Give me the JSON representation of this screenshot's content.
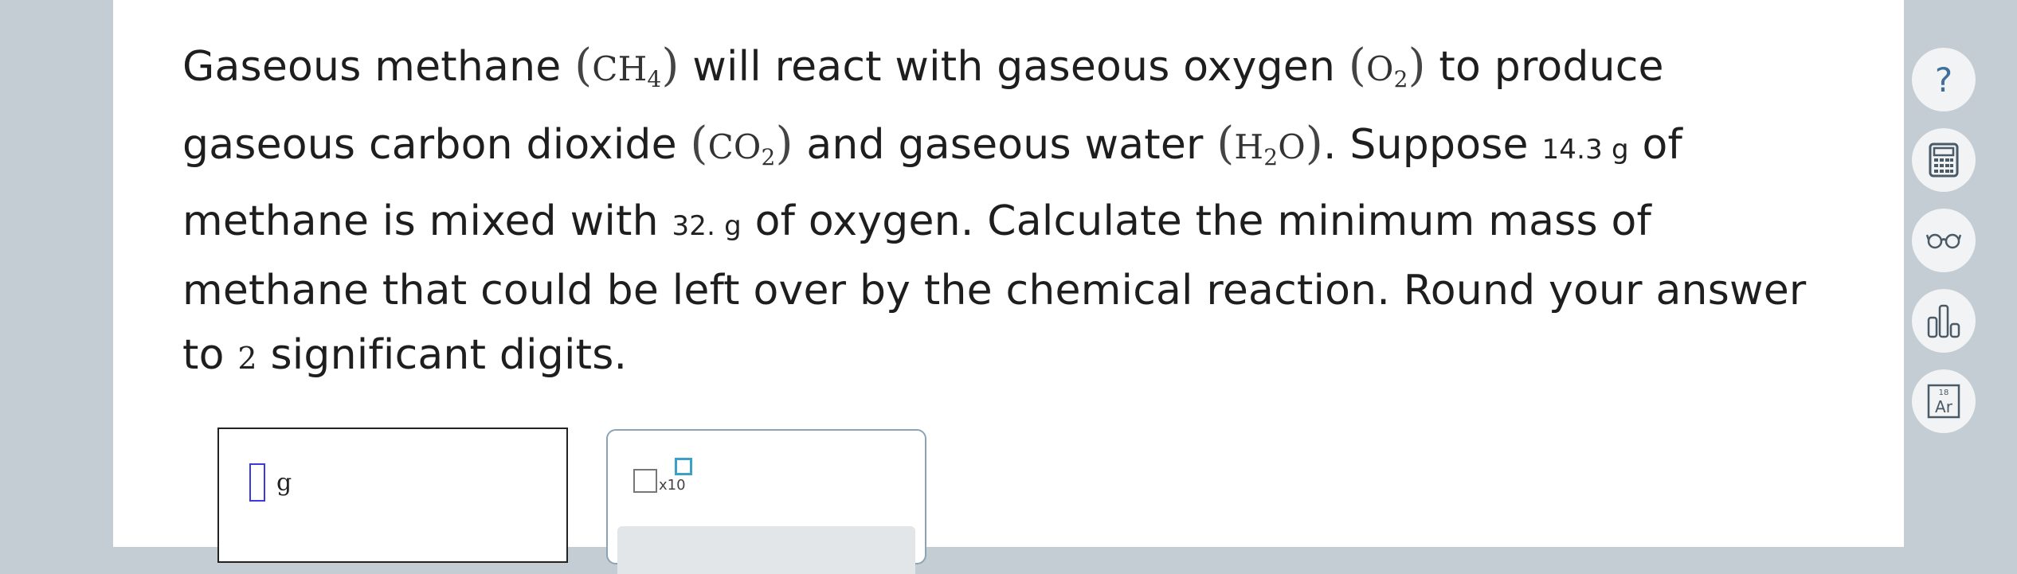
{
  "question": {
    "t1": "Gaseous methane ",
    "ch4_symbol": "CH",
    "ch4_sub": "4",
    "t2": " will react with gaseous oxygen ",
    "o2_symbol": "O",
    "o2_sub": "2",
    "t3": " to produce gaseous carbon dioxide ",
    "co2_symbol": "CO",
    "co2_sub": "2",
    "t4": " and gaseous water ",
    "h2o_h": "H",
    "h2o_sub": "2",
    "h2o_o": "O",
    "t5": ". Suppose ",
    "methane_mass": "14.3 g",
    "t6": " of methane is mixed with ",
    "oxygen_mass": "32. g",
    "t7": " of oxygen. Calculate the minimum mass of methane that could be left over by the chemical reaction. Round your answer to ",
    "sig_digits": "2",
    "t8": " significant digits."
  },
  "tools": [
    {
      "name": "help",
      "icon": "question-icon",
      "glyph": "?"
    },
    {
      "name": "calculator",
      "icon": "calculator-icon"
    },
    {
      "name": "reading-glasses",
      "icon": "glasses-icon"
    },
    {
      "name": "data",
      "icon": "bar-chart-icon"
    },
    {
      "name": "periodic-table",
      "icon": "periodic-table-icon",
      "number": "18",
      "symbol": "Ar"
    }
  ],
  "answer": {
    "value": "",
    "unit": "g"
  },
  "palette": {
    "sci_notation_label": "x10"
  },
  "colors": {
    "background": "#c3cdd3",
    "card": "#ffffff",
    "cursor": "#3a3ae0",
    "exponent_box": "#3aa0cc",
    "palette_border": "#8aa4b6"
  }
}
